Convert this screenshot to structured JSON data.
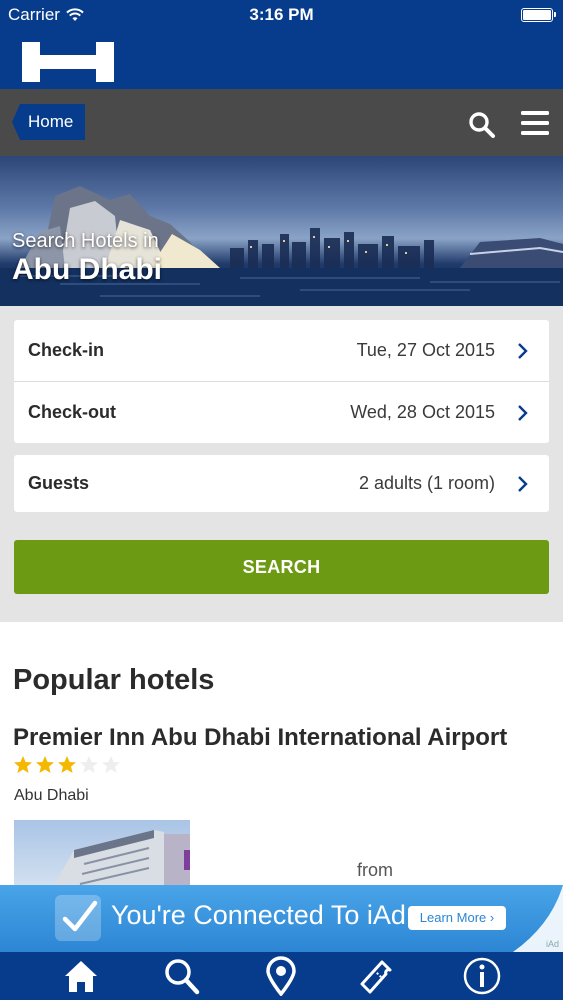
{
  "status_bar": {
    "carrier": "Carrier",
    "time": "3:16 PM"
  },
  "nav": {
    "home_label": "Home"
  },
  "hero": {
    "subtitle": "Search Hotels in",
    "city": "Abu Dhabi"
  },
  "form": {
    "checkin": {
      "label": "Check-in",
      "value": "Tue, 27 Oct 2015"
    },
    "checkout": {
      "label": "Check-out",
      "value": "Wed, 28 Oct 2015"
    },
    "guests": {
      "label": "Guests",
      "value": "2 adults (1 room)"
    },
    "search_label": "SEARCH"
  },
  "popular": {
    "title": "Popular hotels",
    "hotel": {
      "name": "Premier Inn Abu Dhabi International Airport",
      "stars": 3,
      "max_stars": 5,
      "city": "Abu Dhabi",
      "price_prefix": "from"
    }
  },
  "ad": {
    "text": "You're Connected To iAd",
    "button": "Learn More ›",
    "tag": "iAd"
  },
  "colors": {
    "brand_blue": "#073c8c",
    "search_green": "#6c9a13",
    "star_gold": "#f5b800"
  },
  "tabbar": {
    "icons": [
      "home-icon",
      "search-icon",
      "location-pin-icon",
      "ticket-icon",
      "info-icon"
    ]
  }
}
